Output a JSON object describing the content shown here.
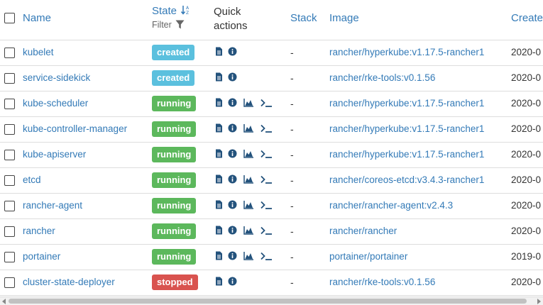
{
  "header": {
    "name": "Name",
    "state": "State",
    "filter": "Filter",
    "quick_actions": "Quick actions",
    "stack": "Stack",
    "image": "Image",
    "created": "Create"
  },
  "icons": {
    "logs": "file-text-icon",
    "inspect": "info-circle-icon",
    "stats": "area-chart-icon",
    "console": "terminal-icon",
    "sort": "sort-alpha-down-icon",
    "filter": "filter-icon"
  },
  "colors": {
    "link": "#337ab7",
    "created": "#5bc0de",
    "running": "#5cb85c",
    "stopped": "#d9534f"
  },
  "rows": [
    {
      "name": "kubelet",
      "state": "created",
      "stack": "-",
      "image": "rancher/hyperkube:v1.17.5-rancher1",
      "created": "2020-0"
    },
    {
      "name": "service-sidekick",
      "state": "created",
      "stack": "-",
      "image": "rancher/rke-tools:v0.1.56",
      "created": "2020-0"
    },
    {
      "name": "kube-scheduler",
      "state": "running",
      "stack": "-",
      "image": "rancher/hyperkube:v1.17.5-rancher1",
      "created": "2020-0"
    },
    {
      "name": "kube-controller-manager",
      "state": "running",
      "stack": "-",
      "image": "rancher/hyperkube:v1.17.5-rancher1",
      "created": "2020-0"
    },
    {
      "name": "kube-apiserver",
      "state": "running",
      "stack": "-",
      "image": "rancher/hyperkube:v1.17.5-rancher1",
      "created": "2020-0"
    },
    {
      "name": "etcd",
      "state": "running",
      "stack": "-",
      "image": "rancher/coreos-etcd:v3.4.3-rancher1",
      "created": "2020-0"
    },
    {
      "name": "rancher-agent",
      "state": "running",
      "stack": "-",
      "image": "rancher/rancher-agent:v2.4.3",
      "created": "2020-0"
    },
    {
      "name": "rancher",
      "state": "running",
      "stack": "-",
      "image": "rancher/rancher",
      "created": "2020-0"
    },
    {
      "name": "portainer",
      "state": "running",
      "stack": "-",
      "image": "portainer/portainer",
      "created": "2019-0"
    },
    {
      "name": "cluster-state-deployer",
      "state": "stopped",
      "stack": "-",
      "image": "rancher/rke-tools:v0.1.56",
      "created": "2020-0"
    }
  ]
}
